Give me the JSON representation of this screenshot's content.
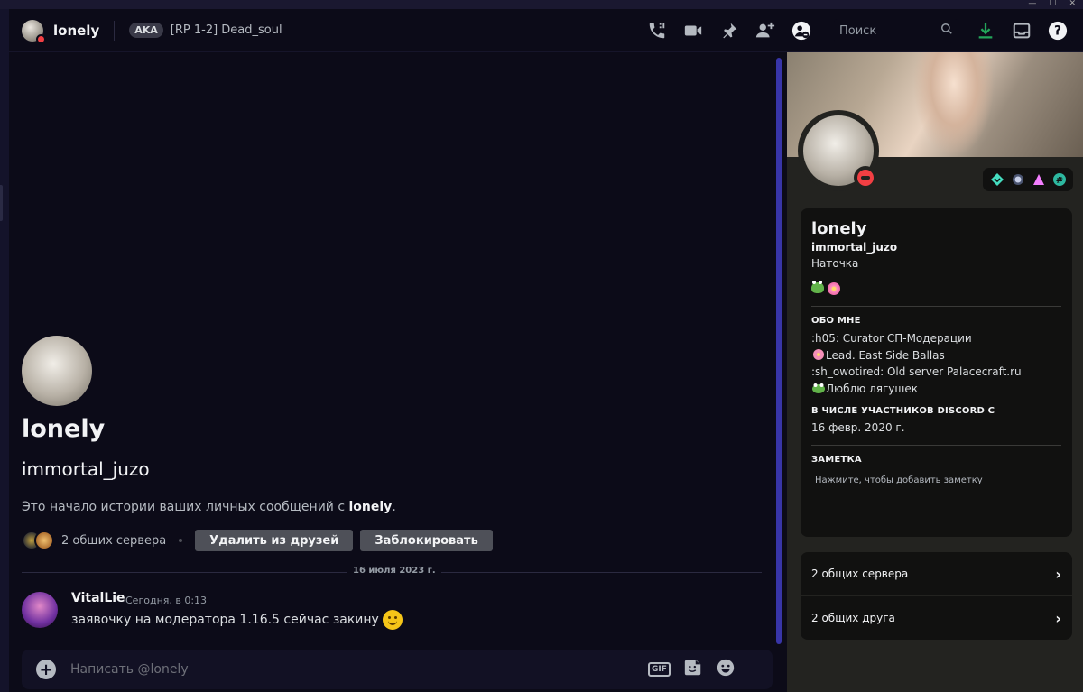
{
  "window": {
    "controls": [
      "—",
      "☐",
      "✕"
    ]
  },
  "header": {
    "name": "lonely",
    "aka_badge": "AKA",
    "aka_text": "[RP 1-2] Dead_soul",
    "search_placeholder": "Поиск"
  },
  "intro": {
    "display_name": "lonely",
    "username": "immortal_juzo",
    "start_text": "Это начало истории ваших личных сообщений с ",
    "start_name": "lonely",
    "start_end": ".",
    "mutual_servers": "2 общих сервера",
    "remove_friend": "Удалить из друзей",
    "block": "Заблокировать"
  },
  "divider_date": "16 июля 2023 г.",
  "message": {
    "author": "VitalLie",
    "time": "Сегодня, в 0:13",
    "text": "заявочку на модератора 1.16.5 сейчас закину"
  },
  "composer": {
    "placeholder": "Написать @lonely",
    "gif": "GIF"
  },
  "profile": {
    "display_name": "lonely",
    "username": "immortal_juzo",
    "pronouns": "Наточка",
    "about_heading": "ОБО МНЕ",
    "about_lines": [
      ":h05: Curator СП-Модерации",
      "Lead. East Side Ballas",
      ":sh_owotired: Old server Palacecraft.ru",
      "Люблю лягушек"
    ],
    "member_heading": "В ЧИСЛЕ УЧАСТНИКОВ DISCORD С",
    "member_since": "16 февр. 2020 г.",
    "note_heading": "ЗАМЕТКА",
    "note_placeholder": "Нажмите, чтобы добавить заметку",
    "mutual_servers": "2 общих сервера",
    "mutual_friends": "2 общих друга"
  },
  "colors": {
    "accent": "#3835a8",
    "dnd": "#f23f43",
    "download": "#23a55a"
  }
}
